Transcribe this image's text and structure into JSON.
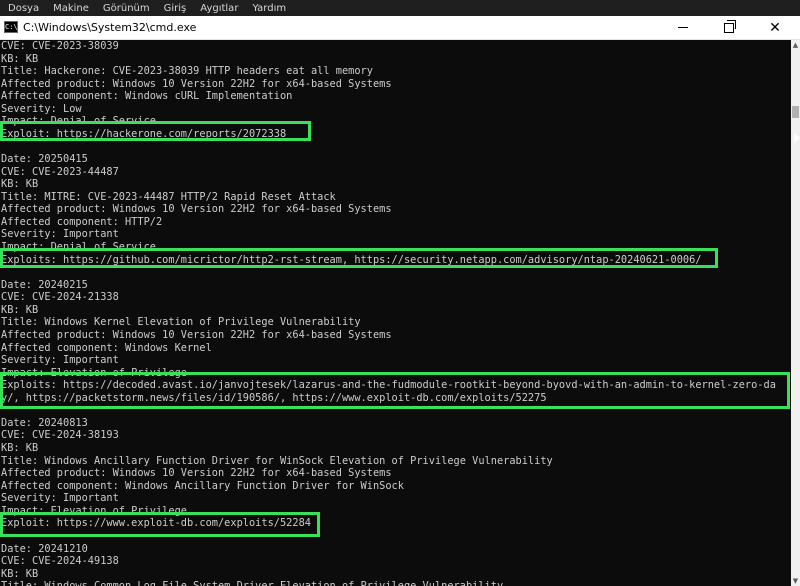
{
  "menu": [
    "Dosya",
    "Makine",
    "Görünüm",
    "Giriş",
    "Aygıtlar",
    "Yardım"
  ],
  "window": {
    "title": "C:\\Windows\\System32\\cmd.exe",
    "icon_text": "C:\\",
    "controls": [
      "minimize",
      "maximize",
      "close"
    ]
  },
  "console_lines": [
    "CVE: CVE-2023-38039",
    "KB: KB",
    "Title: Hackerone: CVE-2023-38039 HTTP headers eat all memory",
    "Affected product: Windows 10 Version 22H2 for x64-based Systems",
    "Affected component: Windows cURL Implementation",
    "Severity: Low",
    "Impact: Denial of Service",
    "Exploit: https://hackerone.com/reports/2072338",
    "",
    "Date: 20250415",
    "CVE: CVE-2023-44487",
    "KB: KB",
    "Title: MITRE: CVE-2023-44487 HTTP/2 Rapid Reset Attack",
    "Affected product: Windows 10 Version 22H2 for x64-based Systems",
    "Affected component: HTTP/2",
    "Severity: Important",
    "Impact: Denial of Service",
    "Exploits: https://github.com/micrictor/http2-rst-stream, https://security.netapp.com/advisory/ntap-20240621-0006/",
    "",
    "Date: 20240215",
    "CVE: CVE-2024-21338",
    "KB: KB",
    "Title: Windows Kernel Elevation of Privilege Vulnerability",
    "Affected product: Windows 10 Version 22H2 for x64-based Systems",
    "Affected component: Windows Kernel",
    "Severity: Important",
    "Impact: Elevation of Privilege",
    "Exploits: https://decoded.avast.io/janvojtesek/lazarus-and-the-fudmodule-rootkit-beyond-byovd-with-an-admin-to-kernel-zero-da",
    "y/, https://packetstorm.news/files/id/190586/, https://www.exploit-db.com/exploits/52275",
    "",
    "Date: 20240813",
    "CVE: CVE-2024-38193",
    "KB: KB",
    "Title: Windows Ancillary Function Driver for WinSock Elevation of Privilege Vulnerability",
    "Affected product: Windows 10 Version 22H2 for x64-based Systems",
    "Affected component: Windows Ancillary Function Driver for WinSock",
    "Severity: Important",
    "Impact: Elevation of Privilege",
    "Exploit: https://www.exploit-db.com/exploits/52284",
    "",
    "Date: 20241210",
    "CVE: CVE-2024-49138",
    "KB: KB",
    "Title: Windows Common Log File System Driver Elevation of Privilege Vulnerability"
  ],
  "highlight_color": "#3ae05a"
}
